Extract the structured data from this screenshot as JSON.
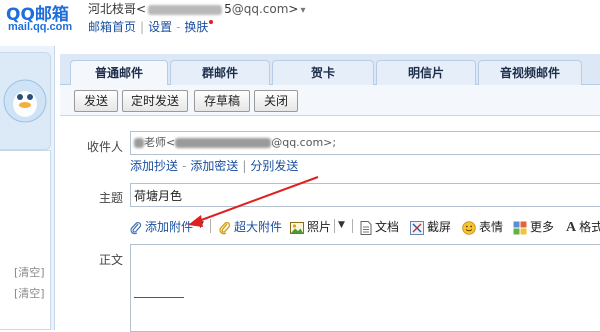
{
  "header": {
    "logo_main": "QQ邮箱",
    "logo_sub": "mail.qq.com",
    "user_name": "河北枝哥",
    "user_email": "@qq.com",
    "links": [
      "邮箱首页",
      "设置",
      "换肤"
    ]
  },
  "sidebar": {
    "clear_labels": [
      "[清空]",
      "[清空]"
    ]
  },
  "tabs": [
    {
      "label": "普通邮件",
      "active": true
    },
    {
      "label": "群邮件",
      "active": false
    },
    {
      "label": "贺卡",
      "active": false
    },
    {
      "label": "明信片",
      "active": false
    },
    {
      "label": "音视频邮件",
      "active": false
    }
  ],
  "toolbar": {
    "send": "发送",
    "schedule": "定时发送",
    "draft": "存草稿",
    "close": "关闭"
  },
  "compose": {
    "to_label": "收件人",
    "to_prefix": "老师",
    "to_suffix": "@qq.com>;",
    "cc_link": "添加抄送",
    "bcc_link": "添加密送",
    "separate_link": "分别发送",
    "subject_label": "主题",
    "subject_value": "荷塘月色",
    "body_label": "正文"
  },
  "format_toolbar": {
    "attach": "添加附件",
    "big_attach": "超大附件",
    "photo": "照片",
    "document": "文档",
    "screenshot": "截屏",
    "emoji": "表情",
    "more": "更多",
    "format": "格式"
  },
  "colors": {
    "brand": "#1e6fd9",
    "link": "#1a4fa0",
    "annotation_arrow": "#e02020"
  }
}
